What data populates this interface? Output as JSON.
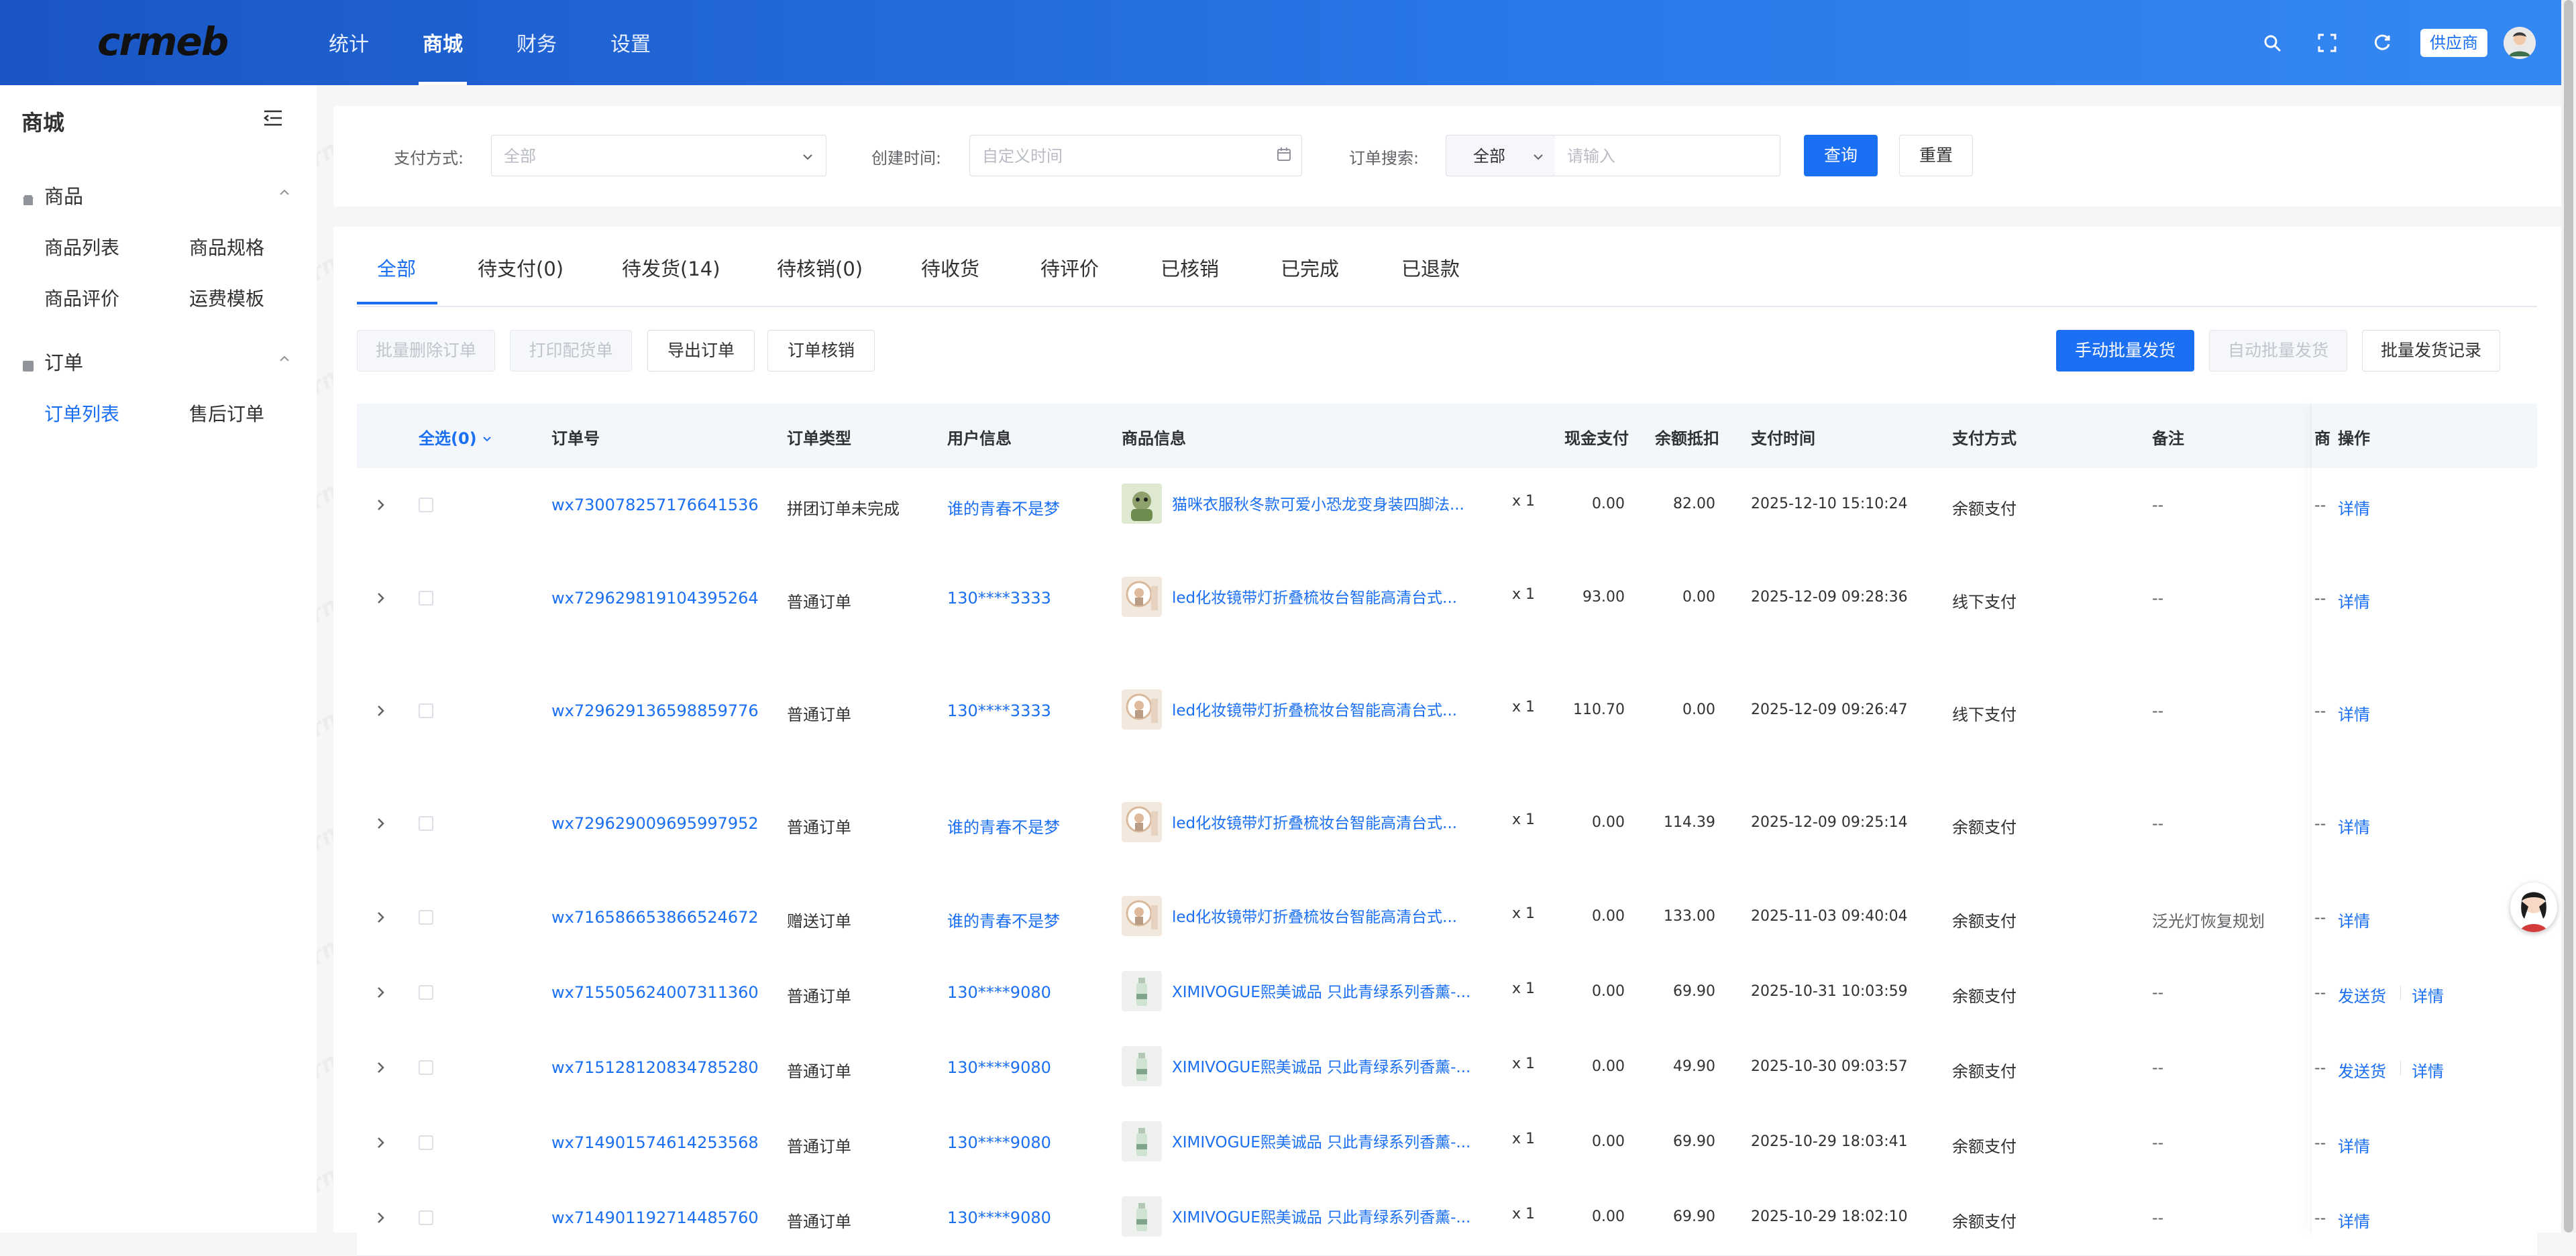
{
  "header": {
    "logo_text": "crmeb",
    "nav": [
      "统计",
      "商城",
      "财务",
      "设置"
    ],
    "active_nav": 1,
    "supplier_label": "供应商",
    "colors": {
      "bg_start": "#1a56c4",
      "bg_end": "#3588f2"
    }
  },
  "sidebar": {
    "title": "商城",
    "groups": [
      {
        "label": "商品",
        "icon": "shop-icon",
        "items": [
          "商品列表",
          "商品规格",
          "商品评价",
          "运费模板"
        ]
      },
      {
        "label": "订单",
        "icon": "order-icon",
        "items": [
          "订单列表",
          "售后订单"
        ]
      }
    ],
    "active_item": "订单列表"
  },
  "filters": {
    "pay_label": "支付方式:",
    "pay_placeholder": "全部",
    "time_label": "创建时间:",
    "time_placeholder": "自定义时间",
    "search_label": "订单搜索:",
    "search_scope": "全部",
    "search_placeholder": "请输入",
    "query_btn": "查询",
    "reset_btn": "重置"
  },
  "tabs": [
    "全部",
    "待支付(0)",
    "待发货(14)",
    "待核销(0)",
    "待收货",
    "待评价",
    "已核销",
    "已完成",
    "已退款"
  ],
  "active_tab": 0,
  "actions": {
    "batch_delete": "批量删除订单",
    "print": "打印配货单",
    "export": "导出订单",
    "verify": "订单核销",
    "manual_ship": "手动批量发货",
    "auto_ship": "自动批量发货",
    "ship_records": "批量发货记录"
  },
  "table": {
    "columns": {
      "select_all": "全选(0)",
      "order_no": "订单号",
      "order_type": "订单类型",
      "user": "用户信息",
      "product": "商品信息",
      "cash": "现金支付",
      "balance": "余额抵扣",
      "pay_time": "支付时间",
      "pay_method": "支付方式",
      "remark": "备注",
      "partial": "商",
      "ops": "操作"
    },
    "rows": [
      {
        "order_no": "wx730078257176641536",
        "type": "拼团订单未完成",
        "user": "谁的青春不是梦",
        "product": "猫咪衣服秋冬款可爱小恐龙变身装四脚法...",
        "thumb": "cat",
        "qty": "x 1",
        "cash": "0.00",
        "balance": "82.00",
        "time": "2025-12-10 15:10:24",
        "method": "余额支付",
        "remark": "--",
        "partial": "--",
        "ops": [
          "详情"
        ]
      },
      {
        "order_no": "wx729629819104395264",
        "type": "普通订单",
        "user": "130****3333",
        "product": "led化妆镜带灯折叠梳妆台智能高清台式...",
        "thumb": "mirror",
        "qty": "x 1",
        "cash": "93.00",
        "balance": "0.00",
        "time": "2025-12-09 09:28:36",
        "method": "线下支付",
        "remark": "--",
        "partial": "--",
        "ops": [
          "详情"
        ]
      },
      {
        "order_no": "wx729629136598859776",
        "type": "普通订单",
        "user": "130****3333",
        "product": "led化妆镜带灯折叠梳妆台智能高清台式...",
        "thumb": "mirror",
        "qty": "x 1",
        "cash": "110.70",
        "balance": "0.00",
        "time": "2025-12-09 09:26:47",
        "method": "线下支付",
        "remark": "--",
        "partial": "--",
        "ops": [
          "详情"
        ]
      },
      {
        "order_no": "wx729629009695997952",
        "type": "普通订单",
        "user": "谁的青春不是梦",
        "product": "led化妆镜带灯折叠梳妆台智能高清台式...",
        "thumb": "mirror",
        "qty": "x 1",
        "cash": "0.00",
        "balance": "114.39",
        "time": "2025-12-09 09:25:14",
        "method": "余额支付",
        "remark": "--",
        "partial": "--",
        "ops": [
          "详情"
        ]
      },
      {
        "order_no": "wx716586653866524672",
        "type": "赠送订单",
        "user": "谁的青春不是梦",
        "product": "led化妆镜带灯折叠梳妆台智能高清台式...",
        "thumb": "mirror",
        "qty": "x 1",
        "cash": "0.00",
        "balance": "133.00",
        "time": "2025-11-03 09:40:04",
        "method": "余额支付",
        "remark": "泛光灯恢复规划",
        "partial": "--",
        "ops": [
          "详情"
        ]
      },
      {
        "order_no": "wx715505624007311360",
        "type": "普通订单",
        "user": "130****9080",
        "product": "XIMIVOGUE熙美诚品 只此青绿系列香薰-...",
        "thumb": "bottle",
        "qty": "x 1",
        "cash": "0.00",
        "balance": "69.90",
        "time": "2025-10-31 10:03:59",
        "method": "余额支付",
        "remark": "--",
        "partial": "--",
        "ops": [
          "发送货",
          "详情"
        ]
      },
      {
        "order_no": "wx715128120834785280",
        "type": "普通订单",
        "user": "130****9080",
        "product": "XIMIVOGUE熙美诚品 只此青绿系列香薰-...",
        "thumb": "bottle",
        "qty": "x 1",
        "cash": "0.00",
        "balance": "49.90",
        "time": "2025-10-30 09:03:57",
        "method": "余额支付",
        "remark": "--",
        "partial": "--",
        "ops": [
          "发送货",
          "详情"
        ]
      },
      {
        "order_no": "wx714901574614253568",
        "type": "普通订单",
        "user": "130****9080",
        "product": "XIMIVOGUE熙美诚品 只此青绿系列香薰-...",
        "thumb": "bottle",
        "qty": "x 1",
        "cash": "0.00",
        "balance": "69.90",
        "time": "2025-10-29 18:03:41",
        "method": "余额支付",
        "remark": "--",
        "partial": "--",
        "ops": [
          "详情"
        ]
      },
      {
        "order_no": "wx714901192714485760",
        "type": "普通订单",
        "user": "130****9080",
        "product": "XIMIVOGUE熙美诚品 只此青绿系列香薰-...",
        "thumb": "bottle",
        "qty": "x 1",
        "cash": "0.00",
        "balance": "69.90",
        "time": "2025-10-29 18:02:10",
        "method": "余额支付",
        "remark": "--",
        "partial": "--",
        "ops": [
          "详情"
        ]
      }
    ]
  },
  "accent_color": "#1a6ff3"
}
